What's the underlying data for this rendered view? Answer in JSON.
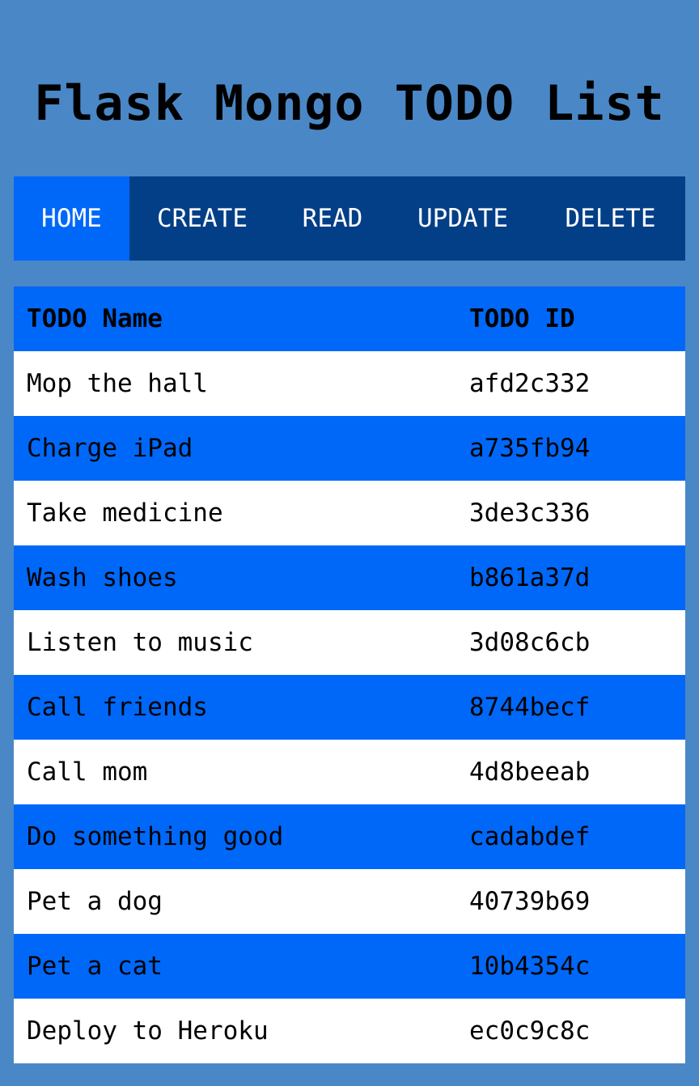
{
  "header": {
    "title": "Flask Mongo TODO List"
  },
  "nav": {
    "items": [
      {
        "label": "HOME",
        "active": true
      },
      {
        "label": "CREATE",
        "active": false
      },
      {
        "label": "READ",
        "active": false
      },
      {
        "label": "UPDATE",
        "active": false
      },
      {
        "label": "DELETE",
        "active": false
      }
    ]
  },
  "table": {
    "headers": [
      "TODO Name",
      "TODO ID"
    ],
    "rows": [
      {
        "name": "Mop the hall",
        "id": "afd2c332"
      },
      {
        "name": "Charge iPad",
        "id": "a735fb94"
      },
      {
        "name": "Take medicine",
        "id": "3de3c336"
      },
      {
        "name": "Wash shoes",
        "id": "b861a37d"
      },
      {
        "name": "Listen to music",
        "id": "3d08c6cb"
      },
      {
        "name": "Call friends",
        "id": "8744becf"
      },
      {
        "name": "Call mom",
        "id": "4d8beeab"
      },
      {
        "name": "Do something good",
        "id": "cadabdef"
      },
      {
        "name": "Pet a dog",
        "id": "40739b69"
      },
      {
        "name": "Pet a cat",
        "id": "10b4354c"
      },
      {
        "name": "Deploy to Heroku",
        "id": "ec0c9c8c"
      }
    ]
  },
  "colors": {
    "background": "#4a87c6",
    "nav_background": "#033f87",
    "accent_blue": "#0068f8",
    "row_white": "#ffffff",
    "text": "#000000",
    "nav_text": "#ffffff"
  }
}
